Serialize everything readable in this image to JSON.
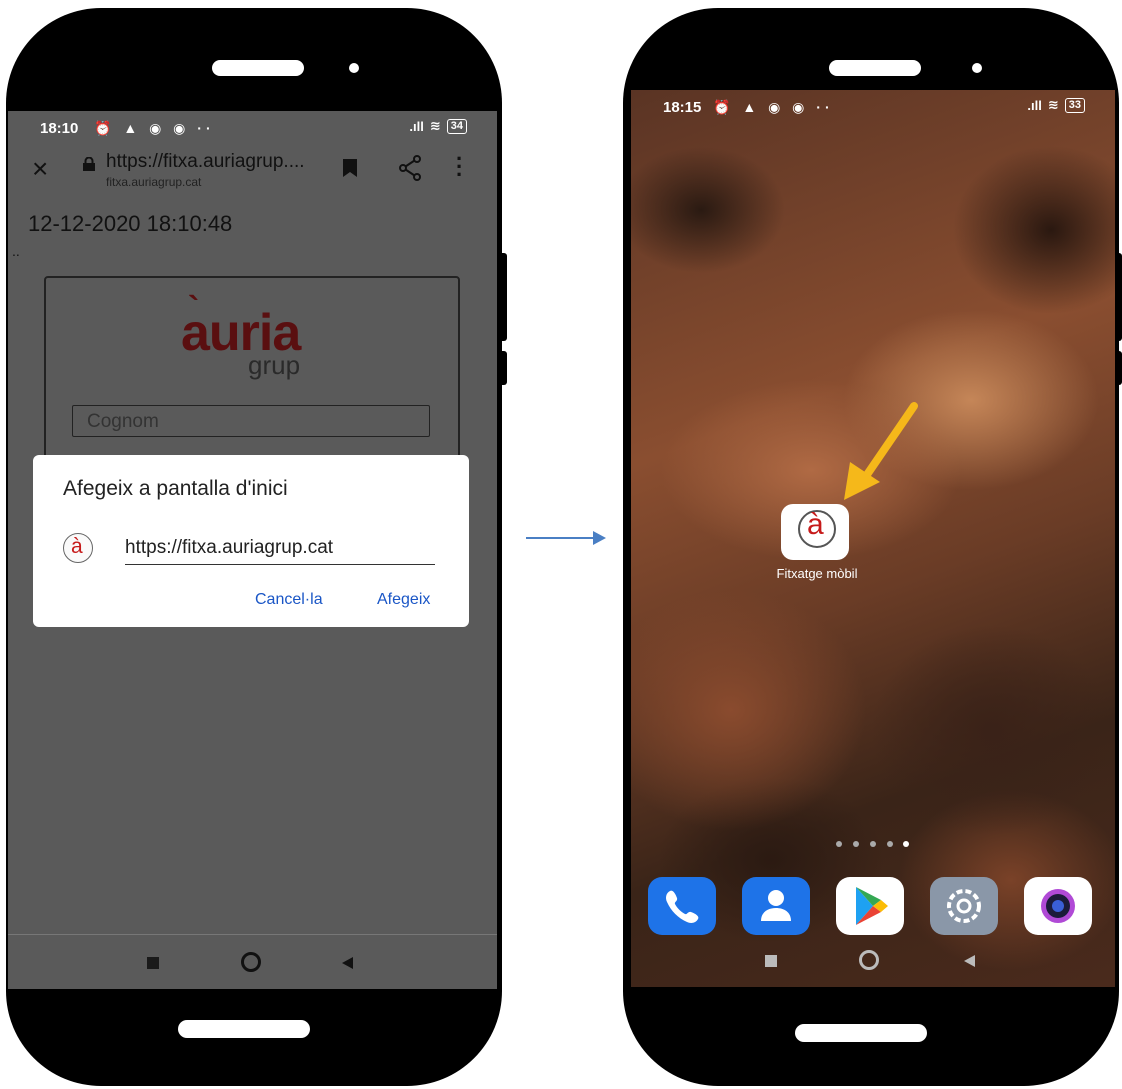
{
  "left_phone": {
    "status": {
      "time": "18:10",
      "icons": "⏰ ▲ ◉ ◉ ··",
      "signal": ".ıll",
      "battery": "34"
    },
    "browser": {
      "url_main": "https://fitxa.auriagrup....",
      "url_sub": "fitxa.auriagrup.cat",
      "close_icon": "close-icon",
      "bookmark_icon": "bookmark-icon",
      "share_icon": "share-icon",
      "menu_icon": "more-vert-icon"
    },
    "page": {
      "datetime": "12-12-2020 18:10:48",
      "dots": "..",
      "logo_text": "auria",
      "logo_accent": "`",
      "logo_sub": "grup",
      "cognom_placeholder": "Cognom"
    },
    "dialog": {
      "title": "Afegeix a pantalla d'inici",
      "icon_glyph": "à",
      "url": "https://fitxa.auriagrup.cat",
      "cancel_label": "Cancel·la",
      "add_label": "Afegeix"
    }
  },
  "right_phone": {
    "status": {
      "time": "18:15",
      "icons": "⏰ ▲ ◉ ◉ ··",
      "signal": ".ıll",
      "battery": "33"
    },
    "app": {
      "glyph": "à",
      "label": "Fitxatge mòbil"
    },
    "dock": [
      {
        "name": "phone-app",
        "bg": "#1e73e8"
      },
      {
        "name": "contacts-app",
        "bg": "#1e73e8"
      },
      {
        "name": "play-store-app",
        "bg": "#ffffff"
      },
      {
        "name": "settings-app",
        "bg": "#8a97a8"
      },
      {
        "name": "camera-app",
        "bg": "#ffffff"
      }
    ]
  },
  "colors": {
    "accent_blue": "#1a56c6",
    "arrow_blue": "#4a7fc4",
    "arrow_yellow": "#f5b81a",
    "brand_red": "#5a0f10"
  }
}
